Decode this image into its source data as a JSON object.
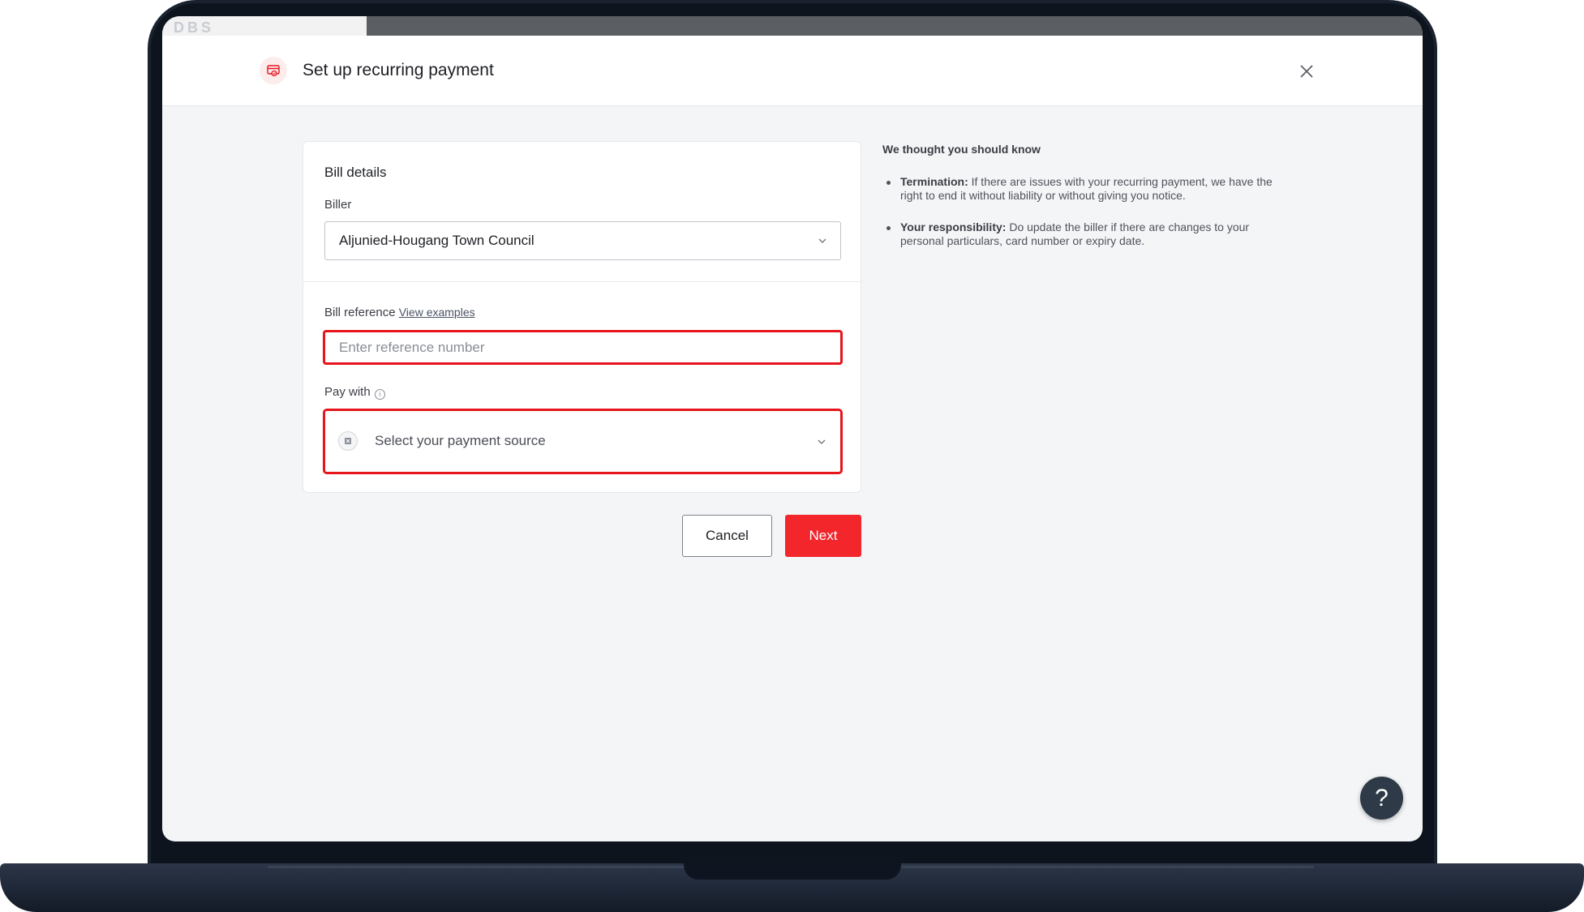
{
  "header": {
    "background_brand": "DBS",
    "title": "Set up recurring payment"
  },
  "form": {
    "section_title": "Bill details",
    "biller_label": "Biller",
    "biller_value": "Aljunied-Hougang Town Council",
    "bill_reference_label": "Bill reference",
    "view_examples_link": "View examples",
    "reference_placeholder": "Enter reference number",
    "pay_with_label": "Pay with",
    "payment_source_placeholder": "Select your payment source"
  },
  "actions": {
    "cancel_label": "Cancel",
    "next_label": "Next"
  },
  "info": {
    "title": "We thought you should know",
    "items": [
      {
        "heading": "Termination:",
        "text": " If there are issues with your recurring payment, we have the right to end it without liability or without giving you notice."
      },
      {
        "heading": "Your responsibility:",
        "text": " Do update the biller if there are changes to your personal particulars, card number or expiry date."
      }
    ]
  },
  "help": {
    "label": "?"
  },
  "colors": {
    "accent": "#f2262b",
    "highlight_border": "#e6141c",
    "laptop_frame": "#1a2230",
    "screen_bg": "#f4f5f7"
  },
  "icons": [
    "recurring-payment-icon",
    "close-icon",
    "chevron-down-icon",
    "info-icon",
    "payment-source-icon",
    "help-icon"
  ]
}
